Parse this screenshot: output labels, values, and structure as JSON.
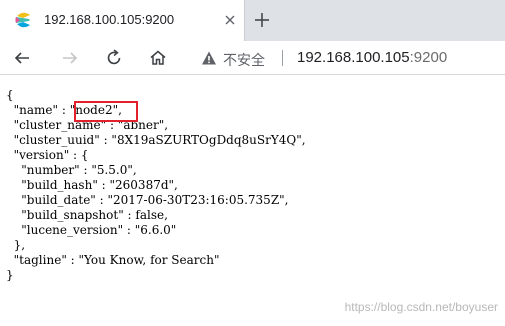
{
  "browser": {
    "tab": {
      "title": "192.168.100.105:9200",
      "favicon": "elastic-logo-icon",
      "close_icon": "close-icon"
    },
    "new_tab_icon": "plus-icon",
    "toolbar": {
      "back_icon": "arrow-left-icon",
      "forward_icon": "arrow-right-icon",
      "reload_icon": "reload-icon",
      "home_icon": "home-icon",
      "security_icon": "warning-triangle-icon",
      "security_label": "不安全",
      "url_host": "192.168.100.105",
      "url_port": ":9200"
    }
  },
  "response": {
    "lines": [
      "{",
      "  \"name\" : \"node2\",",
      "  \"cluster_name\" : \"abner\",",
      "  \"cluster_uuid\" : \"8X19aSZURTOgDdq8uSrY4Q\",",
      "  \"version\" : {",
      "    \"number\" : \"5.5.0\",",
      "    \"build_hash\" : \"260387d\",",
      "    \"build_date\" : \"2017-06-30T23:16:05.735Z\",",
      "    \"build_snapshot\" : false,",
      "    \"lucene_version\" : \"6.6.0\"",
      "  },",
      "  \"tagline\" : \"You Know, for Search\"",
      "}"
    ]
  },
  "watermark": "https://blog.csdn.net/boyuser",
  "colors": {
    "tabstrip": "#dee1e6",
    "highlight_box": "#e3212c",
    "watermark": "#b8b8b8"
  }
}
